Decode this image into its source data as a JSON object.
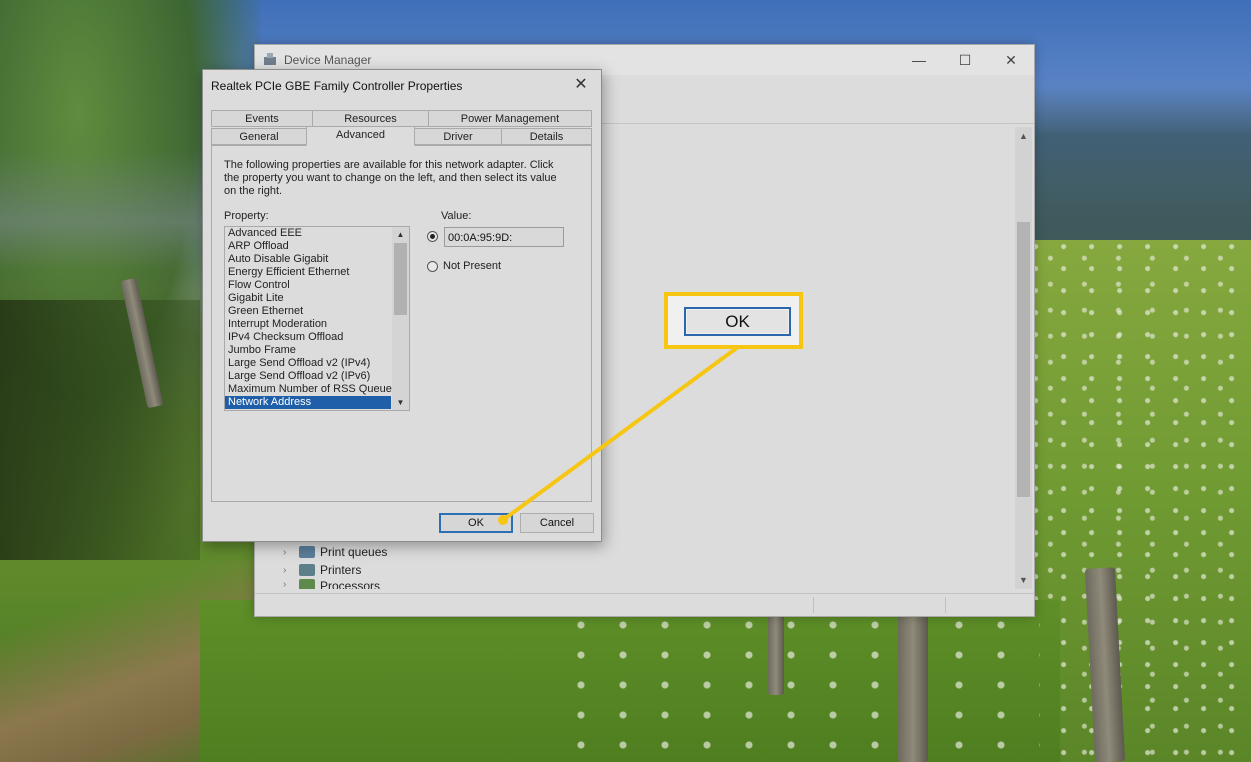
{
  "device_manager": {
    "title": "Device Manager",
    "controls": {
      "minimize": "—",
      "maximize": "☐",
      "close": "✕"
    },
    "tree_items": [
      "Print queues",
      "Printers",
      "Processors"
    ]
  },
  "dialog": {
    "title": "Realtek PCIe GBE Family Controller Properties",
    "close": "✕",
    "tabs_row1": [
      "Events",
      "Resources",
      "Power Management"
    ],
    "tabs_row2": [
      "General",
      "Advanced",
      "Driver",
      "Details"
    ],
    "active_tab": "Advanced",
    "description": "The following properties are available for this network adapter. Click the property you want to change on the left, and then select its value on the right.",
    "property_label": "Property:",
    "value_label": "Value:",
    "properties": [
      "Advanced EEE",
      "ARP Offload",
      "Auto Disable Gigabit",
      "Energy Efficient Ethernet",
      "Flow Control",
      "Gigabit Lite",
      "Green Ethernet",
      "Interrupt Moderation",
      "IPv4 Checksum Offload",
      "Jumbo Frame",
      "Large Send Offload v2 (IPv4)",
      "Large Send Offload v2 (IPv6)",
      "Maximum Number of RSS Queues",
      "Network Address"
    ],
    "selected_property": "Network Address",
    "value_input": "00:0A:95:9D:",
    "not_present_label": "Not Present",
    "ok_label": "OK",
    "cancel_label": "Cancel"
  },
  "callout": {
    "label": "OK",
    "color": "#f6c613"
  },
  "colors": {
    "selection": "#1f5fa9",
    "focus_border": "#2d6fb7"
  }
}
